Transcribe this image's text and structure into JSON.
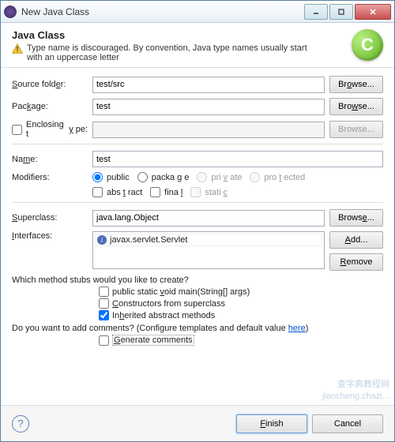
{
  "title": "New Java Class",
  "header": {
    "title": "Java Class",
    "warning": "Type name is discouraged. By convention, Java type names usually start with an uppercase letter",
    "badge": "C"
  },
  "labels": {
    "source_folder": "Source folder:",
    "package": "Package:",
    "enclosing": "Enclosing type:",
    "name": "Name:",
    "modifiers": "Modifiers:",
    "superclass": "Superclass:",
    "interfaces": "Interfaces:"
  },
  "values": {
    "source_folder": "test/src",
    "package": "test",
    "enclosing": "",
    "name": "test",
    "superclass": "java.lang.Object",
    "interface0": "javax.servlet.Servlet"
  },
  "buttons": {
    "browse": "Browse...",
    "add": "Add...",
    "remove": "Remove",
    "finish": "Finish",
    "cancel": "Cancel"
  },
  "modifiers": {
    "public": "public",
    "package": "package",
    "private": "private",
    "protected": "protected",
    "abstract": "abstract",
    "final": "final",
    "static": "static"
  },
  "stubs": {
    "question": "Which method stubs would you like to create?",
    "main": "public static void main(String[] args)",
    "constructors": "Constructors from superclass",
    "inherited": "Inherited abstract methods"
  },
  "comments": {
    "question_pre": "Do you want to add comments? (Configure templates and default value ",
    "here": "here",
    "question_post": ")",
    "generate": "Generate comments"
  },
  "watermark": "查字典教程网\njiaocheng.chazi..."
}
